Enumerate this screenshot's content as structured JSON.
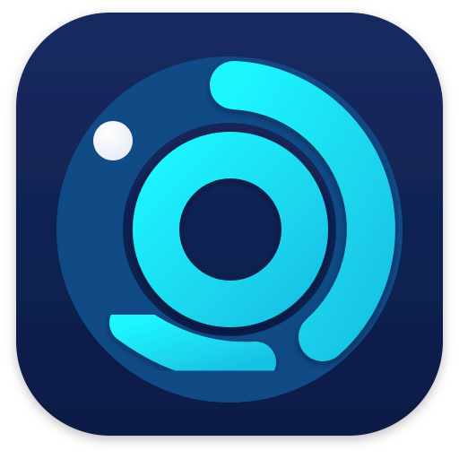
{
  "app_icon": {
    "icon": "circular-rings-app-icon",
    "colors": {
      "tile_top": "#162b61",
      "tile_bottom": "#0b1b45",
      "ring_track": "#104b86",
      "accent_light": "#1df6ff",
      "accent_dark": "#19c2e4",
      "dot": "#e4ebf4"
    }
  }
}
